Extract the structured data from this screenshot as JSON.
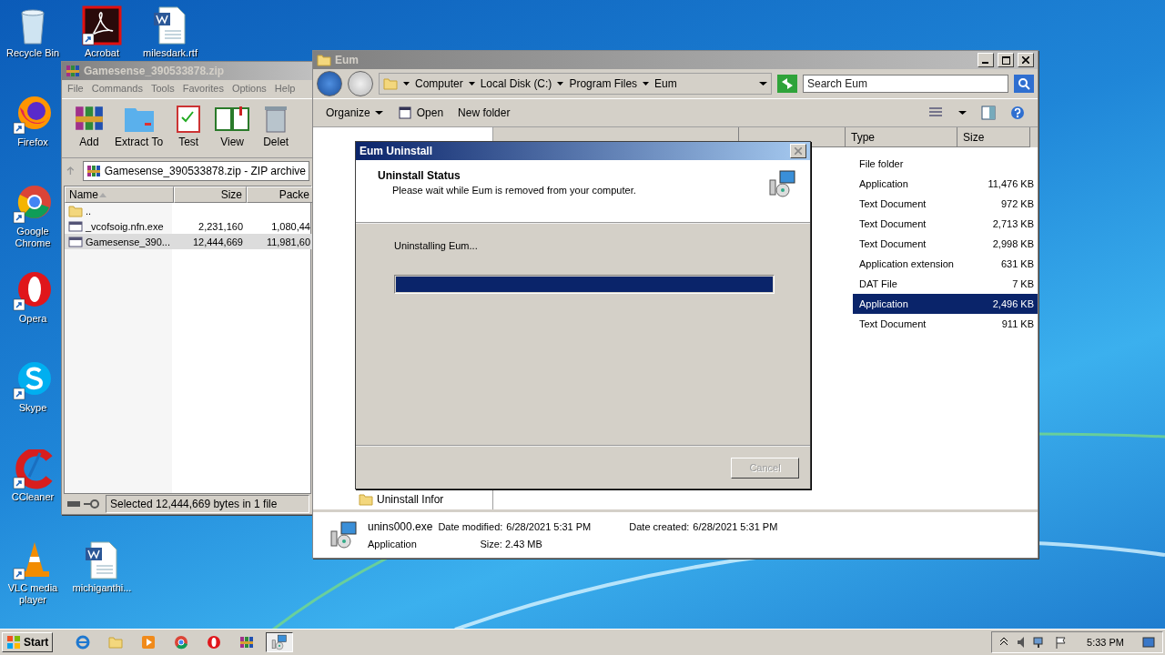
{
  "desktop_icons": [
    {
      "label": "Recycle Bin",
      "kind": "bin"
    },
    {
      "label": "Acrobat",
      "kind": "pdf"
    },
    {
      "label": "milesdark.rtf",
      "kind": "doc"
    },
    {
      "label": "Firefox",
      "kind": "firefox"
    },
    {
      "label": "Google Chrome",
      "kind": "chrome"
    },
    {
      "label": "Opera",
      "kind": "opera"
    },
    {
      "label": "Skype",
      "kind": "skype"
    },
    {
      "label": "CCleaner",
      "kind": "ccleaner"
    },
    {
      "label": "VLC media player",
      "kind": "vlc"
    },
    {
      "label": "michiganthi...",
      "kind": "doc"
    }
  ],
  "winrar": {
    "title": "Gamesense_390533878.zip",
    "menu": [
      "File",
      "Commands",
      "Tools",
      "Favorites",
      "Options",
      "Help"
    ],
    "toolbar": [
      {
        "label": "Add",
        "kind": "add"
      },
      {
        "label": "Extract To",
        "kind": "extract"
      },
      {
        "label": "Test",
        "kind": "test"
      },
      {
        "label": "View",
        "kind": "view"
      },
      {
        "label": "Delet",
        "kind": "delete"
      }
    ],
    "address": "Gamesense_390533878.zip - ZIP archive",
    "columns": [
      "Name",
      "Size",
      "Packe"
    ],
    "rows": [
      {
        "name": "..",
        "kind": "up",
        "selected": false
      },
      {
        "name": "_vcofsoig.nfn.exe",
        "kind": "file",
        "size": "2,231,160",
        "packed": "1,080,44",
        "selected": false
      },
      {
        "name": "Gamesense_390...",
        "kind": "file",
        "size": "12,444,669",
        "packed": "11,981,60",
        "selected": true
      }
    ],
    "status": "Selected 12,444,669 bytes in 1 file"
  },
  "explorer": {
    "title": "Eum",
    "breadcrumbs": [
      "Computer",
      "Local Disk (C:)",
      "Program Files",
      "Eum"
    ],
    "search": {
      "placeholder": "Search Eum"
    },
    "toolbar": [
      {
        "label": "Organize",
        "kind": "menu"
      },
      {
        "label": "Open",
        "kind": "open"
      },
      {
        "label": "New folder",
        "kind": "plain"
      }
    ],
    "nav_items": [
      "Uninstall Infor"
    ],
    "columns": [
      "Type",
      "Size"
    ],
    "rows": [
      {
        "type": "File folder",
        "selected": false
      },
      {
        "type": "Application",
        "size": "11,476 KB",
        "selected": false
      },
      {
        "type": "Text Document",
        "size": "972 KB",
        "selected": false
      },
      {
        "type": "Text Document",
        "size": "2,713 KB",
        "selected": false
      },
      {
        "type": "Text Document",
        "size": "2,998 KB",
        "selected": false
      },
      {
        "type": "Application extension",
        "size": "631 KB",
        "selected": false
      },
      {
        "type": "DAT File",
        "size": "7 KB",
        "selected": false
      },
      {
        "type": "Application",
        "size": "2,496 KB",
        "selected": true
      },
      {
        "type": "Text Document",
        "size": "911 KB",
        "selected": false
      }
    ],
    "details": {
      "name": "unins000.exe",
      "modified_label": "Date modified:",
      "modified": "6/28/2021 5:31 PM",
      "created_label": "Date created:",
      "created": "6/28/2021 5:31 PM",
      "type": "Application",
      "size": "Size: 2.43 MB"
    }
  },
  "dialog": {
    "title": "Eum Uninstall",
    "heading": "Uninstall Status",
    "subheading": "Please wait while Eum is removed from your computer.",
    "status": "Uninstalling Eum...",
    "progress": {
      "level": 1
    },
    "cancel": {
      "label": "Cancel",
      "disabled": true
    }
  },
  "taskbar": {
    "start": "Start",
    "items": [
      {
        "kind": "ie",
        "selected": false
      },
      {
        "kind": "folder",
        "selected": false
      },
      {
        "kind": "media",
        "selected": false
      },
      {
        "kind": "chrome",
        "selected": false
      },
      {
        "kind": "opera",
        "selected": false
      },
      {
        "kind": "winrar",
        "selected": false
      },
      {
        "kind": "installer",
        "selected": true
      }
    ],
    "clock": "5:33 PM"
  }
}
